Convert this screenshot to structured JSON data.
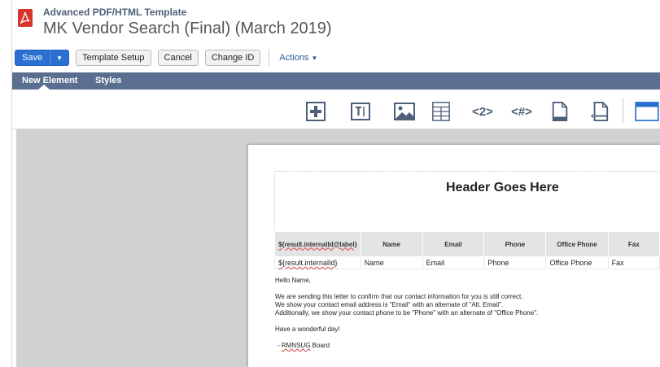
{
  "header": {
    "subtitle": "Advanced PDF/HTML Template",
    "title": "MK Vendor Search (Final) (March 2019)"
  },
  "toolbar": {
    "save_label": "Save",
    "template_setup_label": "Template Setup",
    "cancel_label": "Cancel",
    "change_id_label": "Change ID",
    "actions_label": "Actions"
  },
  "tabs": [
    {
      "label": "New Element",
      "active": true
    },
    {
      "label": "Styles",
      "active": false
    }
  ],
  "element_icons": [
    "add-icon",
    "text-icon",
    "image-icon",
    "table-icon",
    "html-tag-icon",
    "number-tag-icon",
    "page-icon",
    "page-number-icon",
    "header-footer-icon"
  ],
  "document": {
    "header_text": "Header Goes Here",
    "table": {
      "headers": [
        "${result.internalId@label}",
        "Name",
        "Email",
        "Phone",
        "Office Phone",
        "Fax"
      ],
      "row": [
        "${result.internalId}",
        "Name",
        "Email",
        "Phone",
        "Office Phone",
        "Fax"
      ]
    },
    "letter": {
      "greeting": "Hello Name,",
      "line1": "We are sending this letter to confirm that our contact information for you is still correct.",
      "line2": "We show your contact email address is \"Email\" with an alternate of \"Alt. Email\".",
      "line3": "Additionally, we show your contact phone to be \"Phone\" with an alternate of \"Office Phone\".",
      "closing": "Have a wonderful day!",
      "signature_prefix": "- ",
      "signature_org": "RMNSUG",
      "signature_suffix": " Board"
    }
  },
  "colors": {
    "accent": "#2a6fd1",
    "tabbar": "#5a6f90",
    "pdf_red": "#d8342b"
  }
}
